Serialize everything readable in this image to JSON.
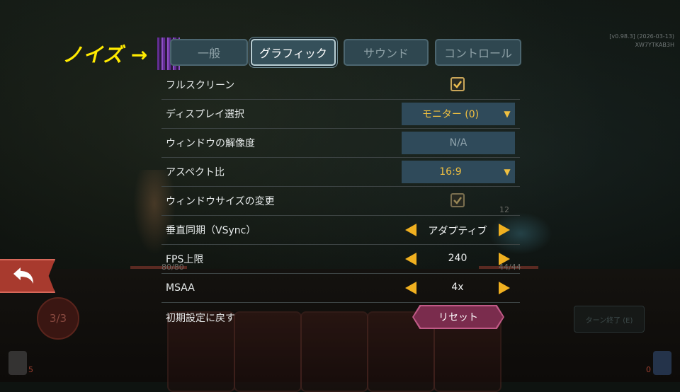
{
  "version": {
    "line1": "[v0.98.3] (2026-03-13)",
    "line2": "XW7YTKAB3H"
  },
  "annotation": {
    "text": "ノイズ →"
  },
  "tabs": [
    {
      "label": "一般"
    },
    {
      "label": "グラフィック"
    },
    {
      "label": "サウンド"
    },
    {
      "label": "コントロール"
    }
  ],
  "settings": {
    "fullscreen": {
      "label": "フルスクリーン",
      "checked": true
    },
    "display": {
      "label": "ディスプレイ選択",
      "value": "モニター (0)"
    },
    "resolution": {
      "label": "ウィンドウの解像度",
      "value": "N/A"
    },
    "aspect": {
      "label": "アスペクト比",
      "value": "16:9"
    },
    "resizable": {
      "label": "ウィンドウサイズの変更",
      "checked": true
    },
    "vsync": {
      "label": "垂直同期（VSync）",
      "value": "アダプティブ"
    },
    "fps": {
      "label": "FPS上限",
      "value": "240"
    },
    "msaa": {
      "label": "MSAA",
      "value": "4x"
    },
    "reset": {
      "label": "初期設定に戻す",
      "button": "リセット"
    }
  },
  "game": {
    "player_hp": "80/80",
    "enemy_hp": "44/44",
    "enemy_attack": "12",
    "energy": "3/3",
    "draw_count": "5",
    "discard_count": "0",
    "end_turn": "ターン終了 (E)"
  },
  "colors": {
    "accent": "#f0b020",
    "reset": "#7a2c4d",
    "back": "#a83a2e",
    "annotation": "#ffea00"
  }
}
